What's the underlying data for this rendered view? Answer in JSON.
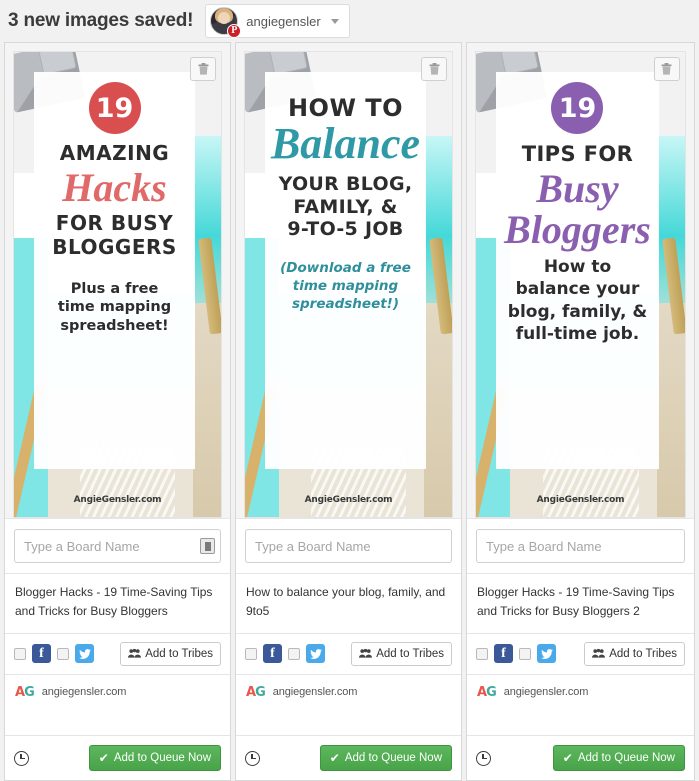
{
  "header": {
    "title": "3 new images saved!",
    "account_name": "angiegensler",
    "pin_badge": "P",
    "caret_icon": "chevron-down-icon"
  },
  "colors": {
    "accent_red": "#d94f4f",
    "accent_purple": "#8b5fb0",
    "accent_teal": "#2f9aa6",
    "queue_green": "#49a349",
    "facebook_blue": "#3b5998",
    "twitter_blue": "#4aa9ea",
    "logo_a": "#e8564a",
    "logo_g": "#3fa9a0"
  },
  "common": {
    "board_placeholder": "Type a Board Name",
    "tribes_label": "Add to Tribes",
    "queue_label": "Add to Queue Now",
    "site_name": "angiegensler.com",
    "logo_a": "A",
    "logo_g": "G",
    "watermark": "AngieGensler.com",
    "delete_icon": "trash-icon",
    "tribes_icon": "people-icon",
    "check_icon": "check-icon",
    "clock_icon": "clock-icon",
    "board_picker_icon": "board-picker-icon",
    "facebook_icon": "facebook-icon",
    "twitter_icon": "twitter-icon"
  },
  "cards": [
    {
      "badge": "19",
      "badge_color": "#d94f4f",
      "line1": "AMAZING",
      "script": "Hacks",
      "script_color": "#e06a6a",
      "line2": "FOR BUSY",
      "line3": "BLOGGERS",
      "sub1": "Plus a free",
      "sub2": "time mapping",
      "sub3": "spreadsheet!",
      "sub_color": "#2d2d2d",
      "sub_italic": false,
      "description": "Blogger Hacks - 19 Time-Saving Tips and Tricks for Busy Bloggers"
    },
    {
      "badge": "",
      "badge_color": "",
      "line1": "HOW TO",
      "script": "Balance",
      "script_color": "#2f9aa6",
      "line2": "YOUR BLOG,",
      "line3": "FAMILY, &",
      "line4": "9-TO-5 JOB",
      "sub1": "(Download a free",
      "sub2": "time mapping",
      "sub3": "spreadsheet!)",
      "sub_color": "#2f8f9c",
      "sub_italic": true,
      "description": "How to balance your blog, family, and 9to5"
    },
    {
      "badge": "19",
      "badge_color": "#8b5fb0",
      "line1": "TIPS FOR",
      "script": "Busy",
      "script2": "Bloggers",
      "script_color": "#8b5fb0",
      "sub1": "How to",
      "sub2": "balance your",
      "sub3": "blog, family, &",
      "sub4": "full-time job.",
      "sub_color": "#2d2d2d",
      "sub_italic": false,
      "description": "Blogger Hacks - 19 Time-Saving Tips and Tricks for Busy Bloggers 2"
    }
  ]
}
